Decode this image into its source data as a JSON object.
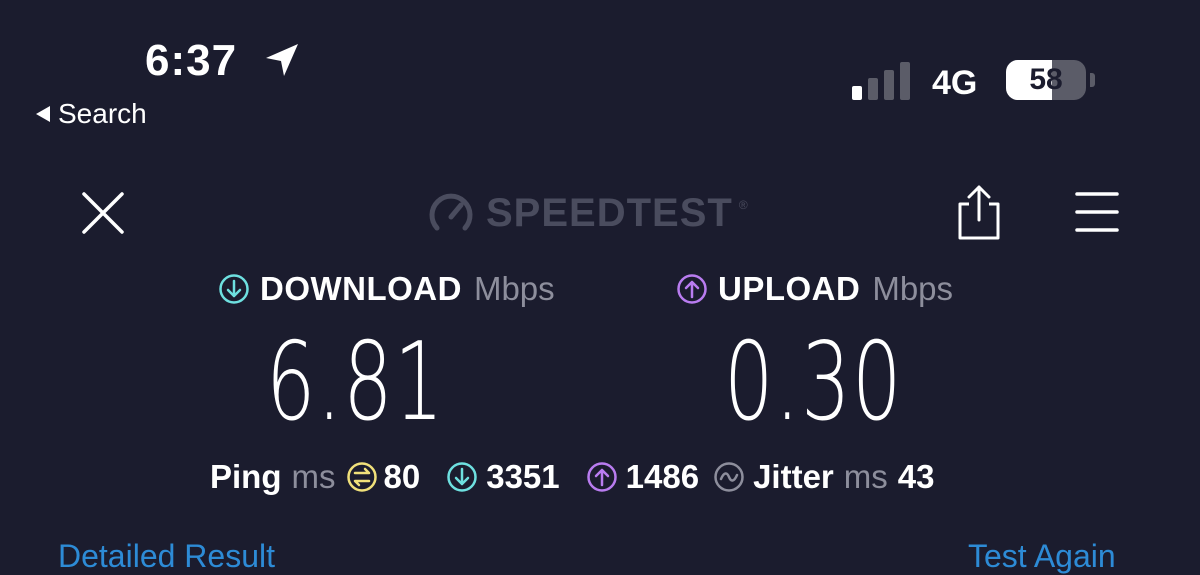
{
  "status_bar": {
    "time": "6:37",
    "back_label": "Search",
    "network": "4G",
    "battery_level": 58,
    "battery_text": "58",
    "icons": [
      "location-arrow-icon",
      "signal-bars-icon",
      "battery-icon"
    ]
  },
  "header": {
    "brand": "SPEEDTEST",
    "trademark": "®",
    "icons": [
      "close-icon",
      "speedometer-icon",
      "share-icon",
      "menu-icon"
    ]
  },
  "download": {
    "label": "DOWNLOAD",
    "unit": "Mbps",
    "value": "6.81"
  },
  "upload": {
    "label": "UPLOAD",
    "unit": "Mbps",
    "value": "0.30"
  },
  "stats": {
    "ping_label": "Ping",
    "ping_unit": "ms",
    "ping_value": "80",
    "download_latency": "3351",
    "upload_latency": "1486",
    "jitter_label": "Jitter",
    "jitter_unit": "ms",
    "jitter_value": "43"
  },
  "footer": {
    "detailed_result": "Detailed Result",
    "test_again": "Test Again"
  },
  "colors": {
    "background": "#1b1c2e",
    "download_accent": "#6ee0e0",
    "upload_accent": "#b97cf0",
    "ping_accent": "#f0e07a",
    "link": "#2d8bd6"
  }
}
